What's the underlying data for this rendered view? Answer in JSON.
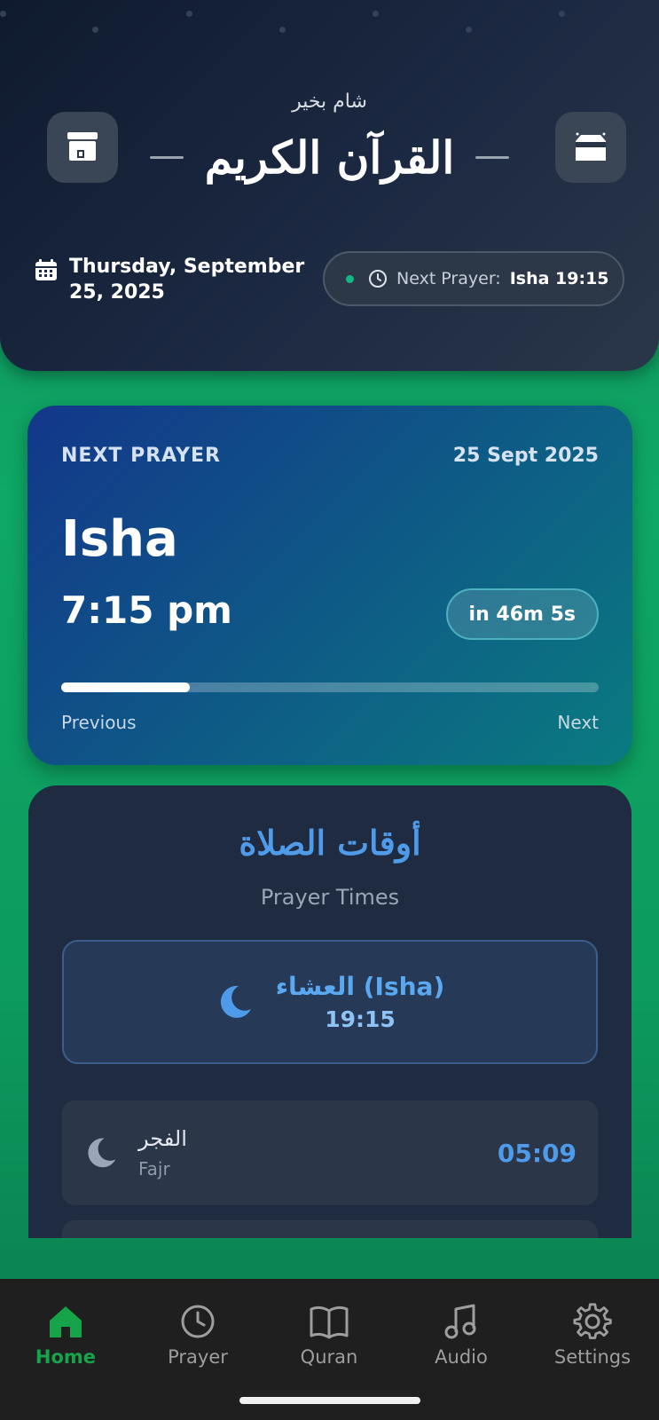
{
  "header": {
    "greeting": "شام بخير",
    "title": "القرآن الكريم",
    "date": "Thursday, September 25, 2025",
    "next_prayer_label": "Next Prayer:",
    "next_prayer_value": "Isha 19:15"
  },
  "next_card": {
    "label": "NEXT PRAYER",
    "date": "25 Sept 2025",
    "name": "Isha",
    "time": "7:15 pm",
    "countdown": "in 46m 5s",
    "progress": 0.24,
    "previous_label": "Previous",
    "next_label": "Next"
  },
  "times_card": {
    "title_ar": "أوقات الصلاة",
    "subtitle": "Prayer Times",
    "current": {
      "name": "العشاء (Isha)",
      "time": "19:15"
    },
    "rows": [
      {
        "ar": "الفجر",
        "en": "Fajr",
        "time": "05:09"
      }
    ]
  },
  "nav": {
    "items": [
      {
        "label": "Home",
        "icon": "home-icon",
        "active": true
      },
      {
        "label": "Prayer",
        "icon": "clock-icon",
        "active": false
      },
      {
        "label": "Quran",
        "icon": "book-icon",
        "active": false
      },
      {
        "label": "Audio",
        "icon": "music-note-icon",
        "active": false
      },
      {
        "label": "Settings",
        "icon": "gear-icon",
        "active": false
      }
    ]
  },
  "colors": {
    "accent_green": "#16a34a",
    "accent_blue": "#4f9bea"
  }
}
